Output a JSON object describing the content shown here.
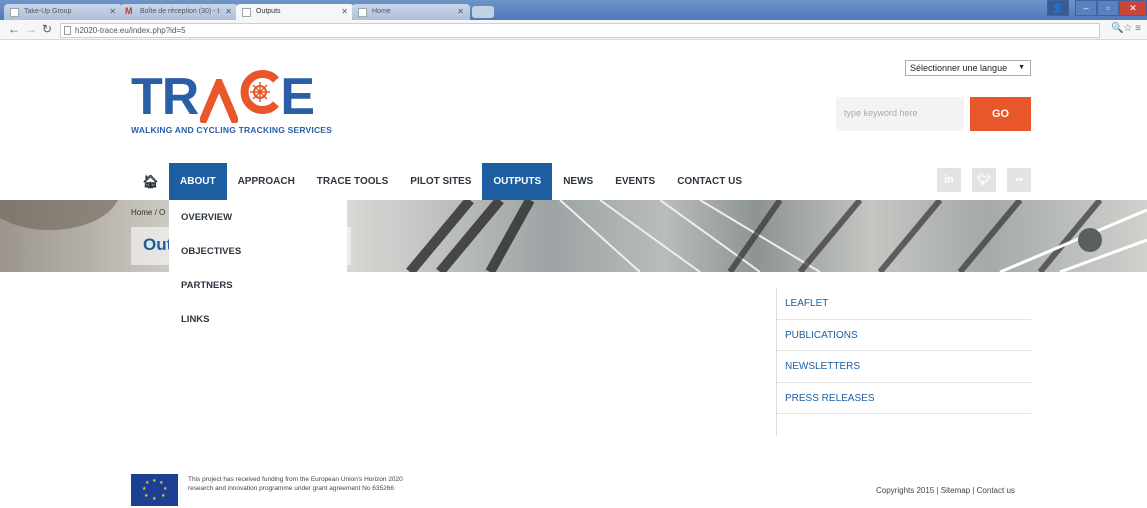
{
  "browser": {
    "tabs": [
      {
        "label": "Take-Up Group",
        "icon": "page-icon"
      },
      {
        "label": "Boîte de réception (30) - t",
        "icon": "gmail-icon"
      },
      {
        "label": "Outputs",
        "icon": "page-icon"
      },
      {
        "label": "Home",
        "icon": "page-icon"
      }
    ],
    "url": "h2020-trace.eu/index.php?id=5"
  },
  "header": {
    "language_select": "Sélectionner une langue",
    "logo_tagline": "WALKING AND CYCLING TRACKING SERVICES",
    "search_placeholder": "type keyword here",
    "go_label": "GO"
  },
  "menu": {
    "items": [
      {
        "label": "ABOUT",
        "selected": true
      },
      {
        "label": "APPROACH"
      },
      {
        "label": "TRACE TOOLS"
      },
      {
        "label": "PILOT SITES"
      },
      {
        "label": "OUTPUTS",
        "selected": true
      },
      {
        "label": "NEWS"
      },
      {
        "label": "EVENTS"
      },
      {
        "label": "CONTACT US"
      }
    ],
    "about_dropdown": [
      "OVERVIEW",
      "OBJECTIVES",
      "PARTNERS",
      "LINKS"
    ]
  },
  "social": [
    "in",
    "twitter",
    "flickr"
  ],
  "banner": {
    "breadcrumb": "Home / O",
    "title": "Out"
  },
  "sidebar": {
    "items": [
      "LEAFLET",
      "PUBLICATIONS",
      "NEWSLETTERS",
      "PRESS RELEASES"
    ]
  },
  "footer": {
    "funding_text": "This project has received funding from the European Union's Horizon 2020 research and innovation programme under grant agreement No 635266",
    "copyright": "Copyrights 2015 | Sitemap | Contact us"
  },
  "colors": {
    "brand_blue": "#1d5ea0",
    "accent_orange": "#e8562a"
  }
}
